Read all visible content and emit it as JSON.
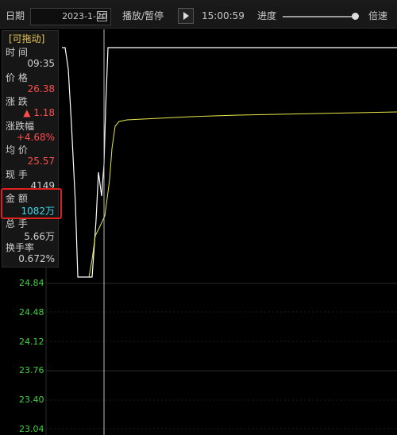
{
  "toolbar": {
    "date_label": "日期",
    "date_value": "2023-1-20",
    "play_pause_label": "播放/暂停",
    "time": "15:00:59",
    "progress_label": "进度",
    "progress_fraction": 0.93,
    "speed_label": "倍速"
  },
  "panel": {
    "title": "[可拖动]",
    "fields": [
      {
        "label": "时  间",
        "value": "09:35"
      },
      {
        "label": "价  格",
        "value": "26.38"
      },
      {
        "label": "涨  跌",
        "value": "▲ 1.18"
      },
      {
        "label": "涨跌幅",
        "value": "+4.68%"
      },
      {
        "label": "均  价",
        "value": "25.57"
      },
      {
        "label": "现  手",
        "value": "4149"
      },
      {
        "label": "金  额",
        "value": "1082万"
      },
      {
        "label": "总  手",
        "value": "5.66万"
      },
      {
        "label": "换手率",
        "value": "0.672%"
      }
    ]
  },
  "colors": {
    "up": "#ff4d4d",
    "neutral": "#d0d0d0",
    "amount": "#3fd8e8",
    "axis": "#3fd13f",
    "price_line": "#ffffff",
    "avg_line": "#e8e84a",
    "highlight": "#e0201c"
  },
  "chart_data": {
    "type": "line",
    "y_ticks": [
      "24.84",
      "24.48",
      "24.12",
      "23.76",
      "23.40",
      "23.04"
    ],
    "crosshair_time": "09:35"
  }
}
